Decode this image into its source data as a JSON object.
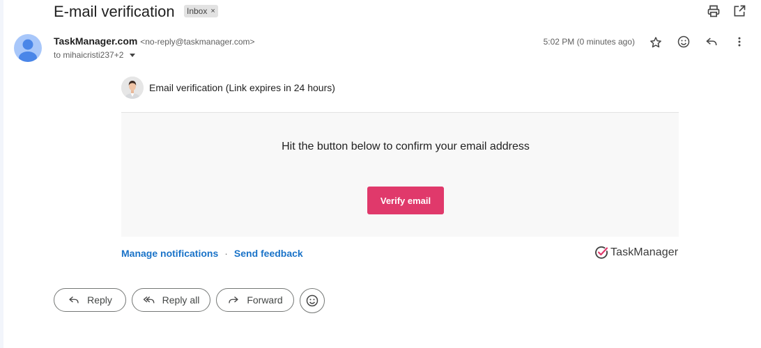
{
  "email": {
    "subject": "E-mail verification",
    "label": "Inbox",
    "label_remove": "×",
    "sender_name": "TaskManager.com",
    "sender_email": "<no-reply@taskmanager.com>",
    "to_text": "to mihaicristi237+2",
    "time": "5:02 PM (0 minutes ago)"
  },
  "icons": {
    "top": [
      "print-icon",
      "open-in-new-window-icon"
    ],
    "actions": [
      "star-icon",
      "emoji-react-icon",
      "reply-icon",
      "more-vert-icon"
    ]
  },
  "body": {
    "preheader": "Email verification (Link expires in 24 hours)",
    "message": "Hit the button below to confirm your email address",
    "verify_button": "Verify email",
    "accent_color": "#e0396b",
    "manage_link": "Manage notifications",
    "separator": "·",
    "feedback_link": "Send feedback",
    "brand": "TaskManager"
  },
  "reply_actions": {
    "reply": "Reply",
    "reply_all": "Reply all",
    "forward": "Forward"
  }
}
